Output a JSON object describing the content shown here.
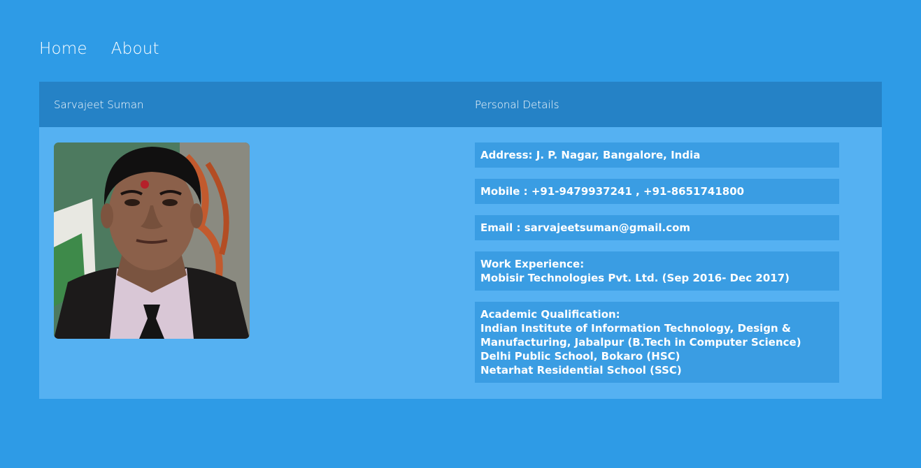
{
  "nav": {
    "home": "Home",
    "about": "About"
  },
  "header": {
    "name": "Sarvajeet Suman",
    "section": "Personal Details"
  },
  "details": {
    "address": "Address: J. P. Nagar, Bangalore, India",
    "mobile": "Mobile : +91-9479937241 , +91-8651741800",
    "email": "Email : sarvajeetsuman@gmail.com",
    "work_title": "Work Experience:",
    "work_1": "Mobisir Technologies Pvt. Ltd. (Sep 2016- Dec 2017)",
    "academic_title": "Academic Qualification:",
    "academic_1": "Indian Institute of Information Technology, Design & Manufacturing, Jabalpur (B.Tech in Computer Science)",
    "academic_2": "Delhi Public School, Bokaro (HSC)",
    "academic_3": "Netarhat Residential School (SSC)"
  },
  "colors": {
    "page_bg": "#2e9be6",
    "card_bg": "#55b1f2",
    "header_bg": "#2582c6",
    "detail_bg": "#3a9de3"
  }
}
